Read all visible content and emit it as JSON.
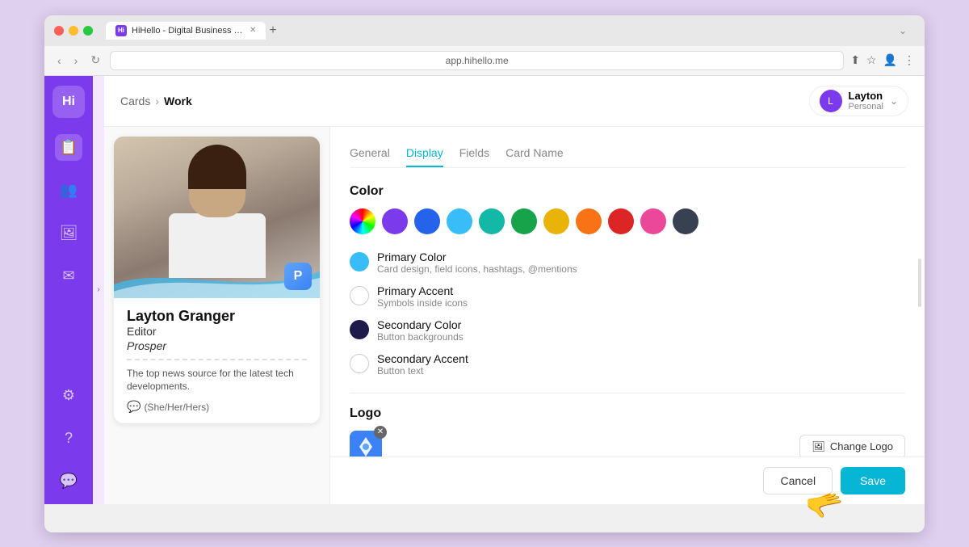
{
  "browser": {
    "tab_title": "HiHello - Digital Business Card",
    "tab_favicon": "Hi",
    "address_bar": "app.hihello.me"
  },
  "breadcrumb": {
    "parent": "Cards",
    "separator": "›",
    "current": "Work"
  },
  "user": {
    "name": "Layton",
    "role": "Personal",
    "avatar_initials": "L"
  },
  "sidebar": {
    "logo": "Hi",
    "icons": [
      "📋",
      "👥",
      "🖼",
      "✉",
      "⚙",
      "?",
      "💬"
    ]
  },
  "tabs": {
    "items": [
      "General",
      "Display",
      "Fields",
      "Card Name"
    ],
    "active": "Display"
  },
  "card": {
    "name": "Layton Granger",
    "title": "Editor",
    "company": "Prosper",
    "bio": "The top news source for the latest tech developments.",
    "pronouns": "(She/Her/Hers)"
  },
  "color_section": {
    "title": "Color",
    "swatches": [
      {
        "name": "rainbow",
        "color": "rainbow"
      },
      {
        "name": "purple",
        "color": "#7c3aed"
      },
      {
        "name": "blue-dark",
        "color": "#2563eb"
      },
      {
        "name": "blue-light",
        "color": "#38bdf8"
      },
      {
        "name": "teal",
        "color": "#14b8a6"
      },
      {
        "name": "green",
        "color": "#16a34a"
      },
      {
        "name": "yellow",
        "color": "#eab308"
      },
      {
        "name": "orange",
        "color": "#f97316"
      },
      {
        "name": "red",
        "color": "#dc2626"
      },
      {
        "name": "pink",
        "color": "#ec4899"
      },
      {
        "name": "dark",
        "color": "#374151"
      }
    ],
    "options": [
      {
        "name": "Primary Color",
        "desc": "Card design, field icons, hashtags, @mentions",
        "indicator_color": "#38bdf8",
        "hollow": false
      },
      {
        "name": "Primary Accent",
        "desc": "Symbols inside icons",
        "indicator_color": "white",
        "hollow": true
      },
      {
        "name": "Secondary Color",
        "desc": "Button backgrounds",
        "indicator_color": "#1e1b4b",
        "hollow": false
      },
      {
        "name": "Secondary Accent",
        "desc": "Button text",
        "indicator_color": "white",
        "hollow": true
      }
    ]
  },
  "logo_section": {
    "title": "Logo",
    "change_button": "Change Logo"
  },
  "actions": {
    "cancel": "Cancel",
    "save": "Save"
  }
}
